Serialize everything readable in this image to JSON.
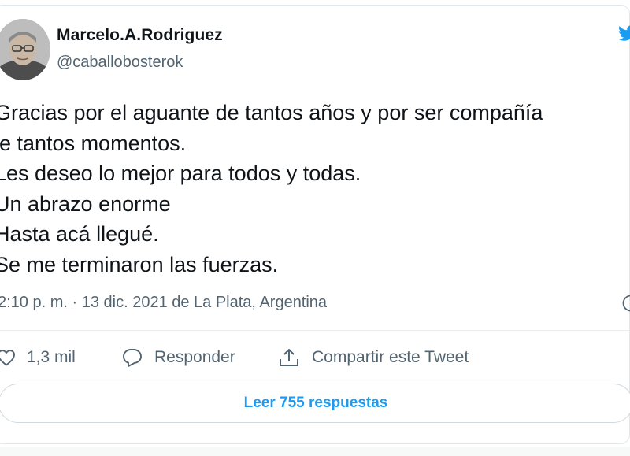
{
  "author": {
    "name": "Marcelo.A.Rodriguez",
    "handle": "@caballobosterok"
  },
  "tweet": {
    "lines": [
      "Gracias por el aguante de tantos años y por ser compañía",
      "le tantos momentos.",
      "Les deseo lo mejor para todos y todas.",
      "Un abrazo enorme",
      "Hasta acá llegué.",
      "Se me terminaron las fuerzas."
    ],
    "meta": "2:10 p. m. · 13 dic. 2021 de La Plata, Argentina"
  },
  "actions": {
    "likes": "1,3 mil",
    "reply_label": "Responder",
    "share_label": "Compartir este Tweet"
  },
  "replies_button": "Leer 755 respuestas",
  "colors": {
    "text": "#0f1419",
    "secondary": "#536471",
    "accent": "#1d9bf0",
    "border": "#cfd9de"
  },
  "icons": [
    "twitter-bird-icon",
    "info-icon",
    "heart-icon",
    "reply-icon",
    "share-icon"
  ]
}
